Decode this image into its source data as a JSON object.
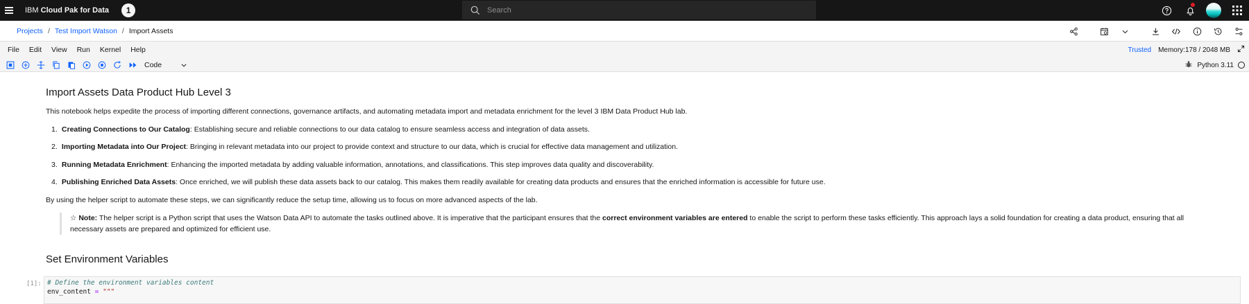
{
  "header": {
    "brand_prefix": "IBM",
    "brand_name": "Cloud Pak for Data",
    "step_badge": "1",
    "search_placeholder": "Search"
  },
  "breadcrumb": {
    "items": [
      "Projects",
      "Test Import Watson"
    ],
    "separator": "/",
    "current": "Import Assets"
  },
  "menubar": {
    "items": [
      "File",
      "Edit",
      "View",
      "Run",
      "Kernel",
      "Help"
    ],
    "trusted": "Trusted",
    "memory": "Memory:178 / 2048 MB"
  },
  "toolbar": {
    "cell_type": "Code",
    "kernel_name": "Python 3.11"
  },
  "notebook": {
    "title": "Import Assets Data Product Hub Level 3",
    "intro": "This notebook helps expedite the process of importing different connections, governance artifacts, and automating metadata import and metadata enrichment for the level 3 IBM Data Product Hub lab.",
    "steps": [
      {
        "num": "1.",
        "bold": "Creating Connections to Our Catalog",
        "text": ": Establishing secure and reliable connections to our data catalog to ensure seamless access and integration of data assets."
      },
      {
        "num": "2.",
        "bold": "Importing Metadata into Our Project",
        "text": ": Bringing in relevant metadata into our project to provide context and structure to our data, which is crucial for effective data management and utilization."
      },
      {
        "num": "3.",
        "bold": "Running Metadata Enrichment",
        "text": ": Enhancing the imported metadata by adding valuable information, annotations, and classifications. This step improves data quality and discoverability."
      },
      {
        "num": "4.",
        "bold": "Publishing Enriched Data Assets",
        "text": ": Once enriched, we will publish these data assets back to our catalog. This makes them readily available for creating data products and ensures that the enriched information is accessible for future use."
      }
    ],
    "summary": "By using the helper script to automate these steps, we can significantly reduce the setup time, allowing us to focus on more advanced aspects of the lab.",
    "note": {
      "star": "☆",
      "label": "Note:",
      "text_before": " The helper script is a Python script that uses the Watson Data API to automate the tasks outlined above. It is imperative that the participant ensures that the ",
      "bold_middle": "correct environment variables are entered",
      "text_after": " to enable the script to perform these tasks efficiently. This approach lays a solid foundation for creating a data product, ensuring that all necessary assets are prepared and optimized for efficient use."
    },
    "section2": "Set Environment Variables",
    "code_cell": {
      "prompt": "[1]:",
      "comment": "# Define the environment variables content",
      "var": "env_content",
      "op": " = ",
      "str": "\"\"\""
    }
  },
  "colors": {
    "header_bg": "#161616",
    "link": "#0f62fe",
    "notif": "#da1e28"
  }
}
